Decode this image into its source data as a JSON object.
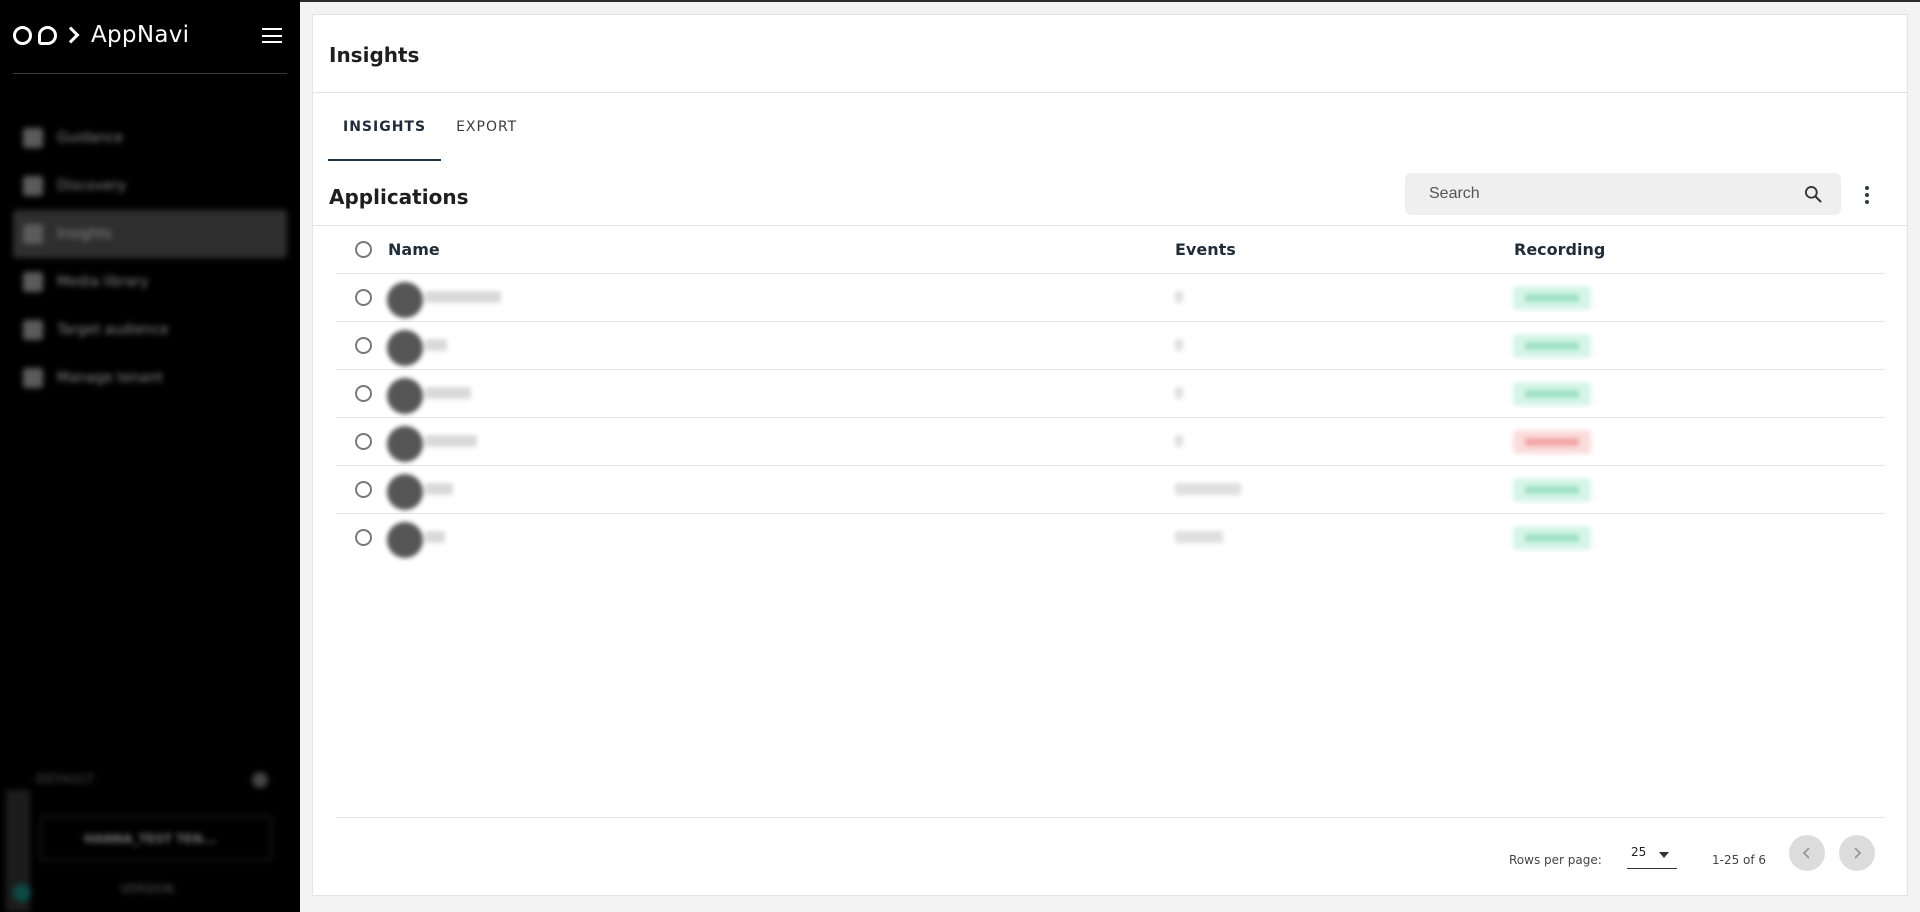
{
  "app": {
    "brand": "AppNavi"
  },
  "sidebar": {
    "items": [
      {
        "label": "Guidance",
        "icon": "guidance-icon"
      },
      {
        "label": "Discovery",
        "icon": "discovery-icon"
      },
      {
        "label": "Insights",
        "icon": "insights-icon",
        "active": true
      },
      {
        "label": "Media library",
        "icon": "media-library-icon"
      },
      {
        "label": "Target audience",
        "icon": "target-audience-icon"
      },
      {
        "label": "Manage tenant",
        "icon": "manage-tenant-icon"
      }
    ],
    "workspace": {
      "label": "DEFAULT",
      "tenant": "HANNA_TEST TEN...",
      "version": "VERSION"
    }
  },
  "header": {
    "title": "Insights"
  },
  "tabs": [
    {
      "label": "INSIGHTS",
      "active": true
    },
    {
      "label": "EXPORT",
      "active": false
    }
  ],
  "section": {
    "title": "Applications"
  },
  "search": {
    "placeholder": "Search"
  },
  "table": {
    "columns": [
      "Name",
      "Events",
      "Recording"
    ],
    "rows": [
      {
        "name": "",
        "events": "",
        "recording": "active"
      },
      {
        "name": "",
        "events": "",
        "recording": "active"
      },
      {
        "name": "",
        "events": "",
        "recording": "active"
      },
      {
        "name": "",
        "events": "",
        "recording": "inactive"
      },
      {
        "name": "",
        "events": "",
        "recording": "active"
      },
      {
        "name": "",
        "events": "",
        "recording": "active"
      }
    ]
  },
  "pagination": {
    "rows_per_page_label": "Rows per page:",
    "rows_per_page_value": "25",
    "range": "1-25 of 6"
  },
  "colors": {
    "sidebar_bg": "#000000",
    "accent": "#1d3448",
    "badge_active": "#d6f5ea",
    "badge_inactive": "#fbdcdc"
  }
}
